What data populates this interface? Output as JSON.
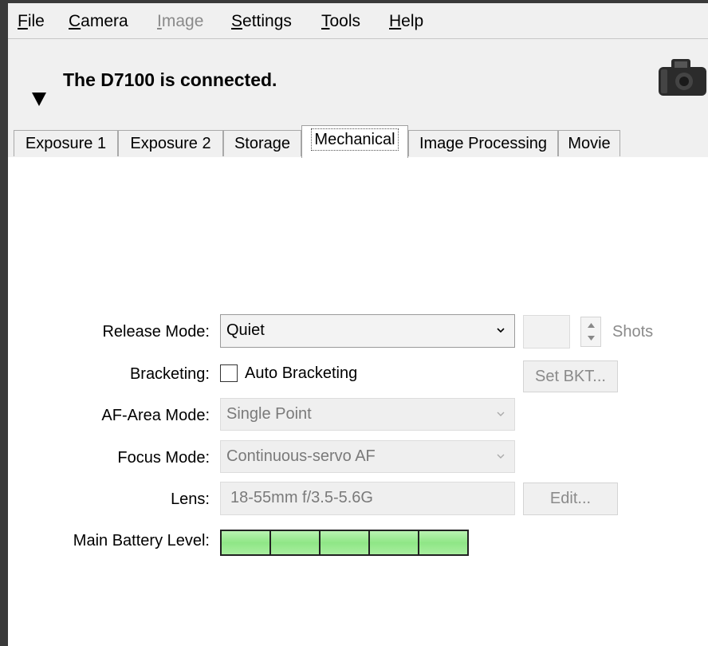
{
  "menu": {
    "file": "File",
    "camera": "Camera",
    "image": "Image",
    "settings": "Settings",
    "tools": "Tools",
    "help": "Help"
  },
  "header": {
    "status": "The D7100 is connected."
  },
  "tabs": [
    {
      "label": "Exposure 1"
    },
    {
      "label": "Exposure 2"
    },
    {
      "label": "Storage"
    },
    {
      "label": "Mechanical"
    },
    {
      "label": "Image Processing"
    },
    {
      "label": "Movie"
    }
  ],
  "active_tab": "Mechanical",
  "mechanical": {
    "release_mode": {
      "label": "Release Mode:",
      "value": "Quiet"
    },
    "shots": {
      "label": "Shots",
      "value": ""
    },
    "bracketing": {
      "label": "Bracketing:",
      "checkbox_label": "Auto Bracketing",
      "checked": false,
      "set_bkt_button": "Set BKT..."
    },
    "af_area_mode": {
      "label": "AF-Area Mode:",
      "value": "Single Point"
    },
    "focus_mode": {
      "label": "Focus Mode:",
      "value": "Continuous-servo AF"
    },
    "lens": {
      "label": "Lens:",
      "value": "18-55mm f/3.5-5.6G",
      "edit_button": "Edit..."
    },
    "battery": {
      "label": "Main Battery Level:",
      "segments_filled": 5,
      "segments_total": 5
    }
  },
  "colors": {
    "battery_fill": "#8fe686",
    "background_chrome": "#f0f0f0"
  }
}
